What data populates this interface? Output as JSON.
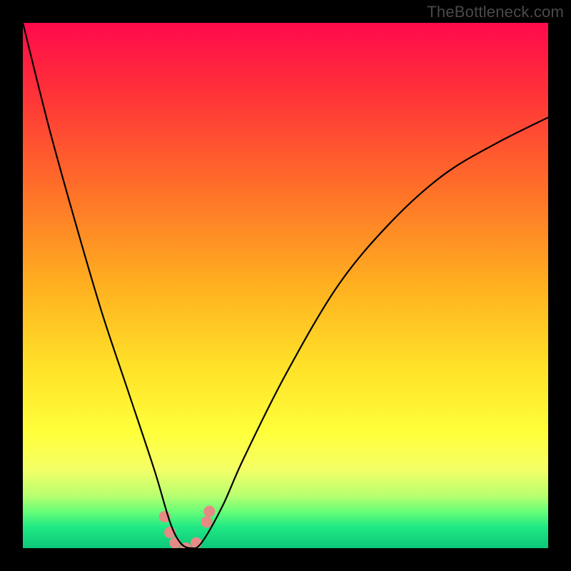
{
  "watermark": "TheBottleneck.com",
  "chart_data": {
    "type": "line",
    "title": "",
    "xlabel": "",
    "ylabel": "",
    "xlim": [
      0,
      100
    ],
    "ylim": [
      0,
      100
    ],
    "gradient_stops": [
      {
        "pct": 0,
        "color": "#ff0a4c"
      },
      {
        "pct": 12,
        "color": "#ff2e3a"
      },
      {
        "pct": 30,
        "color": "#ff6a2a"
      },
      {
        "pct": 50,
        "color": "#ffb020"
      },
      {
        "pct": 65,
        "color": "#ffe028"
      },
      {
        "pct": 78,
        "color": "#ffff3a"
      },
      {
        "pct": 85,
        "color": "#f4ff66"
      },
      {
        "pct": 90,
        "color": "#b8ff70"
      },
      {
        "pct": 93,
        "color": "#68ff78"
      },
      {
        "pct": 96,
        "color": "#20e884"
      },
      {
        "pct": 100,
        "color": "#0cc87a"
      }
    ],
    "series": [
      {
        "name": "curve",
        "x": [
          0,
          5,
          10,
          15,
          20,
          25,
          28,
          30,
          32,
          34,
          38,
          42,
          50,
          60,
          70,
          80,
          90,
          100
        ],
        "y": [
          100,
          80,
          62,
          45,
          30,
          15,
          5,
          1,
          0,
          1,
          8,
          17,
          33,
          50,
          62,
          71,
          77,
          82
        ]
      }
    ],
    "markers": {
      "name": "highlight-points",
      "color": "#e68a86",
      "radius": 8,
      "points": [
        {
          "x": 27,
          "y": 6
        },
        {
          "x": 28,
          "y": 3
        },
        {
          "x": 29,
          "y": 1
        },
        {
          "x": 31,
          "y": 0
        },
        {
          "x": 33,
          "y": 1
        },
        {
          "x": 35,
          "y": 5
        },
        {
          "x": 35.5,
          "y": 7
        }
      ]
    }
  }
}
